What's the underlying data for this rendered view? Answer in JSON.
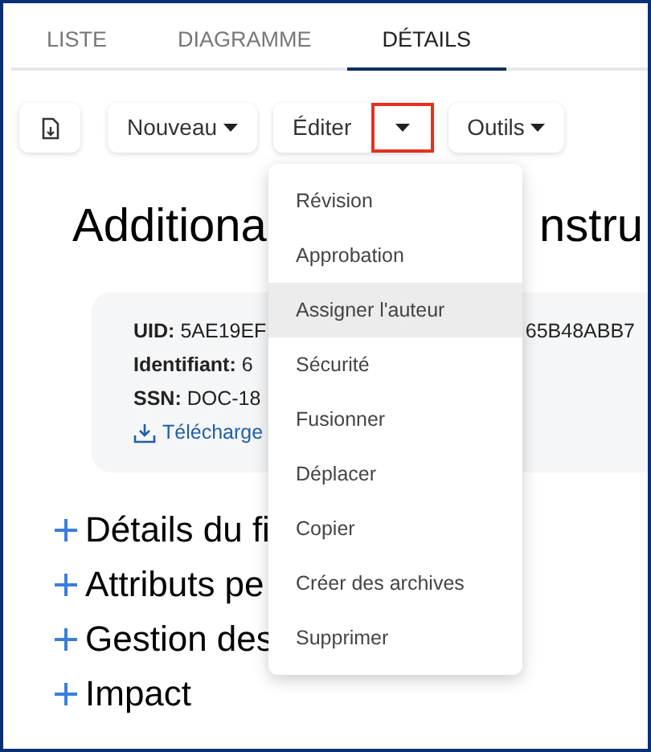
{
  "tabs": [
    {
      "label": "LISTE",
      "selected": false
    },
    {
      "label": "DIAGRAMME",
      "selected": false
    },
    {
      "label": "DÉTAILS",
      "selected": true
    }
  ],
  "toolbar": {
    "buttons": [
      {
        "kind": "icon"
      },
      {
        "kind": "dropdown",
        "label": "Nouveau"
      },
      {
        "kind": "split",
        "label": "Éditer",
        "caret_annotated": true
      },
      {
        "kind": "dropdown",
        "label": "Outils"
      }
    ]
  },
  "title": {
    "left": "Additiona",
    "right": "nstru"
  },
  "info_card": {
    "rows": [
      {
        "label": "UID:",
        "value": "5AE19EF",
        "value_right": "65B48ABB7"
      },
      {
        "label": "Identifiant:",
        "value": "6"
      },
      {
        "label": "SSN:",
        "value": "DOC-18"
      }
    ],
    "link": "Télécharge"
  },
  "sections": [
    {
      "label": "Détails du fi",
      "expanded": false
    },
    {
      "label": "Attributs pe",
      "expanded": false
    },
    {
      "label": "Gestion des",
      "expanded": false
    },
    {
      "label": "Impact",
      "expanded": false
    }
  ],
  "menu": [
    {
      "label": "Révision",
      "highlighted": false
    },
    {
      "label": "Approbation",
      "highlighted": false
    },
    {
      "label": "Assigner l'auteur",
      "highlighted": true
    },
    {
      "label": "Sécurité",
      "highlighted": false
    },
    {
      "label": "Fusionner",
      "highlighted": false
    },
    {
      "label": "Déplacer",
      "highlighted": false
    },
    {
      "label": "Copier",
      "highlighted": false
    },
    {
      "label": "Créer des archives",
      "highlighted": false
    },
    {
      "label": "Supprimer",
      "highlighted": false
    }
  ]
}
